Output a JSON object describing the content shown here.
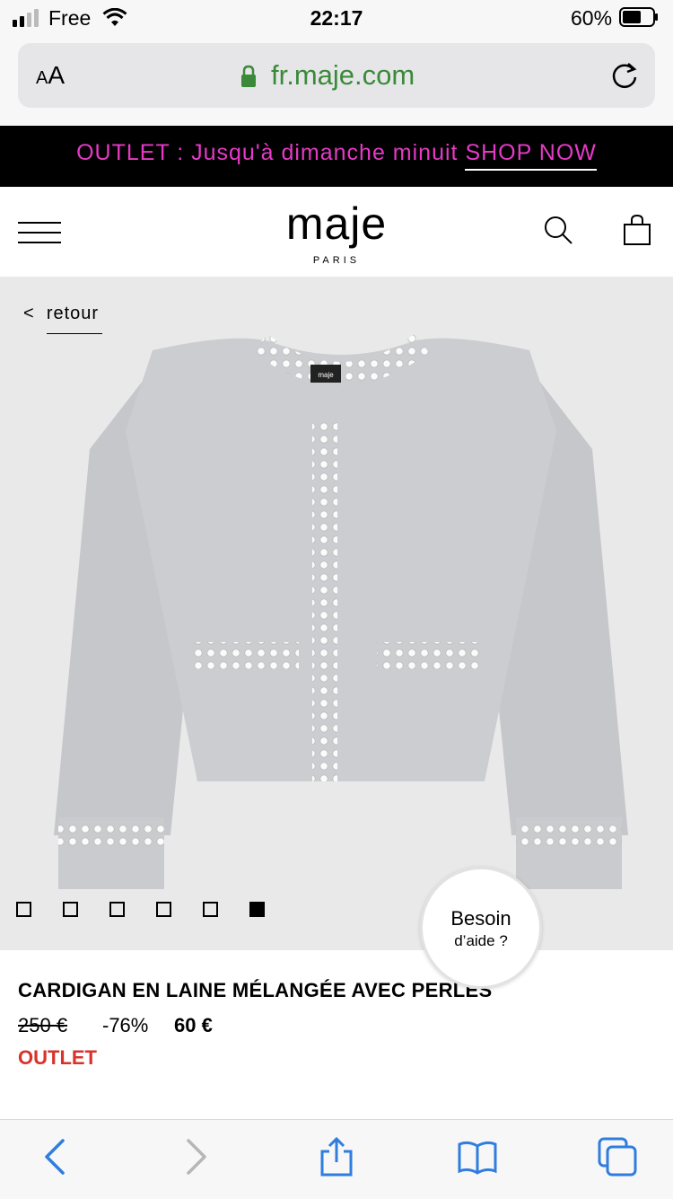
{
  "status_bar": {
    "carrier": "Free",
    "time": "22:17",
    "battery": "60%"
  },
  "browser": {
    "text_size_label_small": "A",
    "text_size_label_large": "A",
    "url": "fr.maje.com"
  },
  "banner": {
    "text": "OUTLET : Jusqu'à dimanche minuit",
    "link": "SHOP NOW"
  },
  "header": {
    "logo": "maje",
    "logo_sub": "PARIS"
  },
  "hero": {
    "back_label": "retour",
    "back_arrow": "<",
    "image_label": "maje",
    "carousel_total": 6,
    "carousel_active": 6
  },
  "help": {
    "line1": "Besoin",
    "line2": "d’aide ?"
  },
  "product": {
    "title": "CARDIGAN EN LAINE MÉLANGÉE AVEC PERLES",
    "price_old": "250 €",
    "discount": "-76%",
    "price_new": "60 €",
    "tag": "OUTLET"
  },
  "colors": {
    "banner_accent": "#e63ac6",
    "outlet_red": "#d8322a",
    "url_green": "#3a8a3a",
    "ios_blue": "#2f7ddf"
  }
}
